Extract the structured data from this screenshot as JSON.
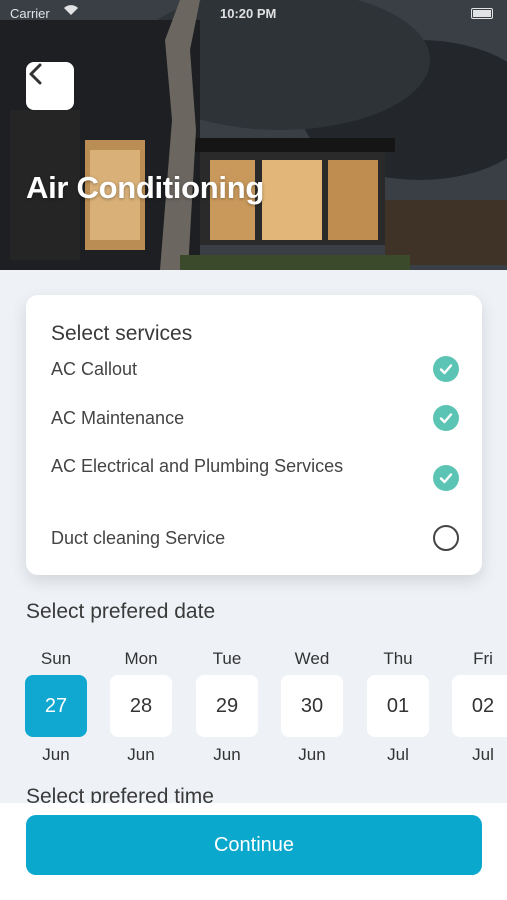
{
  "status_bar": {
    "carrier": "Carrier",
    "time": "10:20 PM"
  },
  "header": {
    "title": "Air Conditioning",
    "back_icon": "chevron-left-icon"
  },
  "services": {
    "title": "Select services",
    "items": [
      {
        "label": "AC Callout",
        "selected": true
      },
      {
        "label": "AC Maintenance",
        "selected": true
      },
      {
        "label": "AC Electrical and Plumbing Services",
        "selected": true
      },
      {
        "label": "Duct cleaning Service",
        "selected": false
      }
    ]
  },
  "date": {
    "heading": "Select prefered date",
    "days": [
      {
        "day": "Sun",
        "date": "27",
        "month": "Jun",
        "selected": true
      },
      {
        "day": "Mon",
        "date": "28",
        "month": "Jun",
        "selected": false
      },
      {
        "day": "Tue",
        "date": "29",
        "month": "Jun",
        "selected": false
      },
      {
        "day": "Wed",
        "date": "30",
        "month": "Jun",
        "selected": false
      },
      {
        "day": "Thu",
        "date": "01",
        "month": "Jul",
        "selected": false
      },
      {
        "day": "Fri",
        "date": "02",
        "month": "Jul",
        "selected": false
      }
    ]
  },
  "time": {
    "heading": "Select prefered time"
  },
  "footer": {
    "continue_label": "Continue"
  },
  "colors": {
    "accent": "#0aa8cc",
    "check": "#5cc4b4",
    "selected_date": "#10a7d1"
  }
}
